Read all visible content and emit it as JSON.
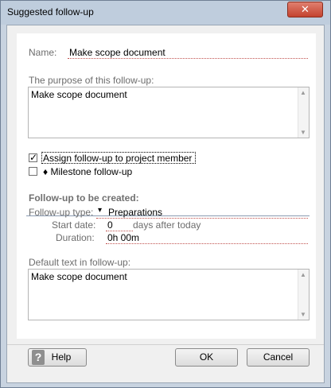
{
  "window": {
    "title": "Suggested follow-up",
    "close_glyph": "✕"
  },
  "form": {
    "name_label": "Name:",
    "name_value": "Make scope document",
    "purpose_label": "The purpose of this follow-up:",
    "purpose_value": "Make scope document",
    "assign_label": "Assign follow-up to project member",
    "assign_checked": true,
    "milestone_label": "♦ Milestone follow-up",
    "milestone_checked": false,
    "section_title": "Follow-up to be created:",
    "type_label": "Follow-up type:",
    "type_arrow": "▾",
    "type_value": "Preparations",
    "start_label": "Start date:",
    "start_value": "0",
    "start_suffix": "days after today",
    "duration_label": "Duration:",
    "duration_value": "0h 00m",
    "default_text_label": "Default text in follow-up:",
    "default_text_value": "Make scope document"
  },
  "buttons": {
    "help_label": "Help",
    "help_icon_glyph": "?",
    "ok_label": "OK",
    "cancel_label": "Cancel"
  },
  "icons": {
    "close": "close-icon",
    "help": "help-icon",
    "dropdown": "chevron-down-icon",
    "milestone": "diamond-icon"
  }
}
